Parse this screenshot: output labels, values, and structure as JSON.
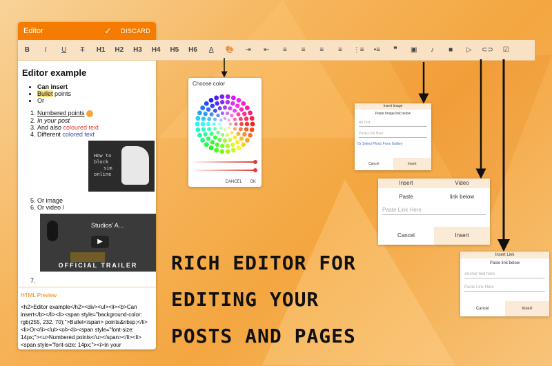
{
  "editor": {
    "title": "Editor",
    "check_label": "✓",
    "discard_label": "DISCARD",
    "heading": "Editor example",
    "bullets": [
      "Can insert",
      "Bullet",
      " points",
      "Or"
    ],
    "numbered": [
      "Numbered points",
      "In your post",
      "And also ",
      "coloured text",
      "Different ",
      "colored text"
    ],
    "image_text": [
      "How to",
      "block",
      "sim",
      "online"
    ],
    "items_after": [
      "Or image",
      "Or video /"
    ],
    "video_title": "Studios' A...",
    "video_trailer": "OFFICIAL TRAILER",
    "item7": "",
    "preview_label": "HTML Preview",
    "preview_html": "<h2>Editor example</h2><div><ul><li><b>Can insert</b></li><li><span style=\"background-color: rgb(255, 232, 70);\">Bullet</span> points&nbsp;</li><li>Or</li></ul><ol><li><span style=\"font-size: 14px;\"><u>Numbered points</u></span></li><li><span style=\"font-size: 14px;\"><i>In your"
  },
  "toolbar": {
    "buttons": [
      {
        "name": "bold",
        "label": "B"
      },
      {
        "name": "italic",
        "label": "I"
      },
      {
        "name": "underline",
        "label": "U"
      },
      {
        "name": "strikethrough",
        "label": "T"
      },
      {
        "name": "h1",
        "label": "H1"
      },
      {
        "name": "h2",
        "label": "H2"
      },
      {
        "name": "h3",
        "label": "H3"
      },
      {
        "name": "h4",
        "label": "H4"
      },
      {
        "name": "h5",
        "label": "H5"
      },
      {
        "name": "h6",
        "label": "H6"
      },
      {
        "name": "text-color",
        "label": "A"
      },
      {
        "name": "palette-icon",
        "label": "🎨"
      },
      {
        "name": "indent",
        "label": "⇥"
      },
      {
        "name": "outdent",
        "label": "⇤"
      },
      {
        "name": "align-left",
        "label": "≡"
      },
      {
        "name": "align-center",
        "label": "≡"
      },
      {
        "name": "align-justify",
        "label": "≡"
      },
      {
        "name": "align-right",
        "label": "≡"
      },
      {
        "name": "ordered-list",
        "label": "⋮≡"
      },
      {
        "name": "bullet-list",
        "label": "•≡"
      },
      {
        "name": "blockquote",
        "label": "❞"
      },
      {
        "name": "insert-image",
        "label": "▣"
      },
      {
        "name": "insert-audio",
        "label": "♪"
      },
      {
        "name": "insert-video",
        "label": "■"
      },
      {
        "name": "insert-youtube",
        "label": "▷"
      },
      {
        "name": "insert-link",
        "label": "⊂⊃"
      },
      {
        "name": "checkbox",
        "label": "☑"
      }
    ]
  },
  "color_picker": {
    "title": "Choose color",
    "cancel": "CANCEL",
    "ok": "OK"
  },
  "insert_image": {
    "title": "Insert Image",
    "subtitle": "Paste Image link below",
    "alt_placeholder": "Alt Text",
    "link_placeholder": "Paste Link Here",
    "gallery": "Or Select Photo From Gallery",
    "cancel": "Cancel",
    "insert": "Insert"
  },
  "insert_video": {
    "title_left": "Insert",
    "title_right": "Video",
    "sub_left": "Paste",
    "sub_right": "link below",
    "link_placeholder": "Paste Link Here",
    "cancel": "Cancel",
    "insert": "Insert"
  },
  "insert_link": {
    "title": "Insert Link",
    "subtitle": "Paste link below",
    "anchor_placeholder": "Anchor text here",
    "link_placeholder": "Paste Link Here",
    "cancel": "Cancel",
    "insert": "Insert"
  },
  "headline": {
    "line1": "RICH EDITOR FOR",
    "line2": "EDITING YOUR",
    "line3": "POSTS AND PAGES"
  }
}
